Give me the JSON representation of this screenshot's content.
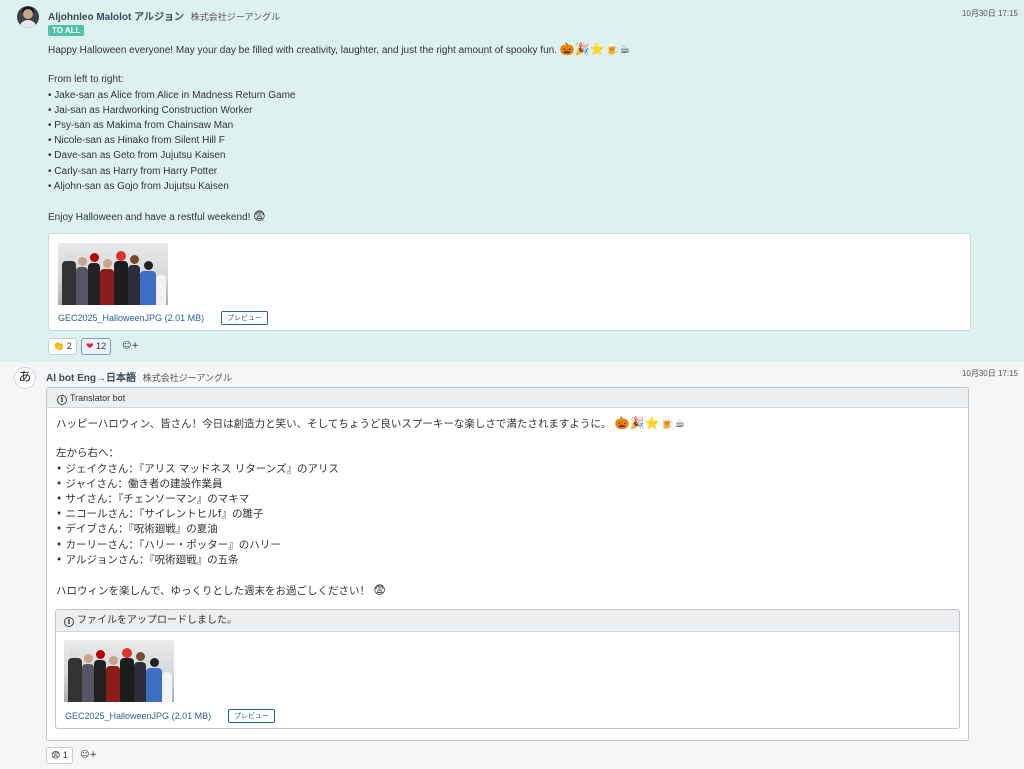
{
  "message1": {
    "sender": "Aljohnleo Malolot アルジョン",
    "company": "株式会社ジーアングル",
    "timestamp": "10月30日 17:15",
    "badge": "TO ALL",
    "lines": [
      "Happy Halloween everyone! May your day be filled with creativity, laughter, and just the right amount of spooky fun.",
      "",
      "From left to right:",
      "• Jake-san as Alice from Alice in Madness Return Game",
      "• Jai-san as Hardworking Construction Worker",
      "• Psy-san as Makima from Chainsaw Man",
      "• Nicole-san as Hinako from Silent Hill F",
      "• Dave-san as Geto from Jujutsu Kaisen",
      "• Carly-san as Harry from Harry Potter",
      "• Aljohn-san as Gojo from Jujutsu Kaisen",
      "",
      "Enjoy Halloween and have a restful weekend!"
    ],
    "line1_emojis": "🎃🎉⭐🍺☕",
    "last_line_emoji": "😨",
    "attachment": {
      "filename": "GEC2025_HalloweenJPG",
      "size": "(2.01 MB)",
      "preview_label": "プレビュー"
    },
    "reactions": [
      {
        "icon": "clap-icon",
        "glyph": "👏",
        "count": "2"
      },
      {
        "icon": "heart-icon",
        "glyph": "❤",
        "count": "12"
      }
    ],
    "add_reaction_glyph": "☺+"
  },
  "message2": {
    "avatar_char": "あ",
    "sender": "AI bot Eng→日本語",
    "company": "株式会社ジーアングル",
    "timestamp": "10月30日 17:15",
    "box_title": "Translator bot",
    "lines": [
      "ハッピーハロウィン、皆さん！今日は創造力と笑い、そしてちょうど良いスプーキーな楽しさで満たされますように。",
      "",
      "左から右へ：",
      "• ジェイクさん：『アリス マッドネス リターンズ』のアリス",
      "• ジャイさん：働き者の建設作業員",
      "• サイさん：『チェンソーマン』のマキマ",
      "• ニコールさん：『サイレントヒルf』の雛子",
      "• デイブさん：『呪術廻戦』の夏油",
      "• カーリーさん：『ハリー・ポッター』のハリー",
      "• アルジョンさん：『呪術廻戦』の五条",
      "",
      "ハロウィンを楽しんで、ゆっくりとした週末をお過ごしください！"
    ],
    "line1_emojis": "🎃🎉⭐🍺☕",
    "last_line_emoji": "😨",
    "upload_title": "ファイルをアップロードしました。",
    "attachment": {
      "filename": "GEC2025_HalloweenJPG",
      "size": "(2.01 MB)",
      "preview_label": "プレビュー"
    },
    "reactions": [
      {
        "icon": "scared-face-icon",
        "glyph": "😨",
        "count": "1"
      }
    ],
    "add_reaction_glyph": "☺+"
  }
}
